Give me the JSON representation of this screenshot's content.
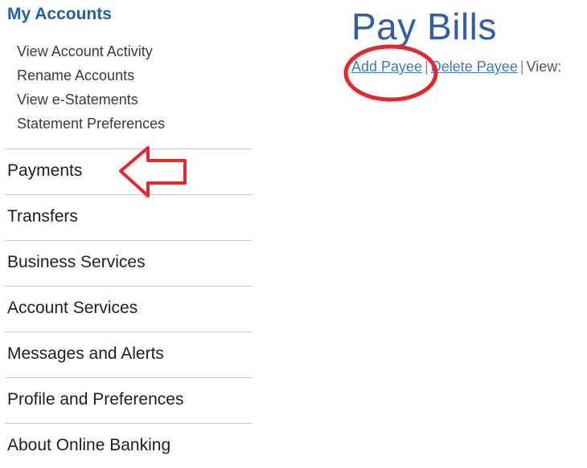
{
  "sidebar": {
    "section_title": "My Accounts",
    "sub_items": [
      {
        "label": "View Account Activity"
      },
      {
        "label": "Rename Accounts"
      },
      {
        "label": "View e-Statements"
      },
      {
        "label": "Statement Preferences"
      }
    ],
    "nav_items": [
      {
        "label": "Payments"
      },
      {
        "label": "Transfers"
      },
      {
        "label": "Business Services"
      },
      {
        "label": "Account Services"
      },
      {
        "label": "Messages and Alerts"
      },
      {
        "label": "Profile and Preferences"
      },
      {
        "label": "About Online Banking"
      }
    ]
  },
  "main": {
    "title": "Pay Bills",
    "actions": {
      "add_payee": "Add Payee",
      "separator": "|",
      "delete_payee": "Delete Payee",
      "view_label": "View:"
    }
  },
  "annotations": {
    "color": "#e8262b",
    "arrow_icon": "left-arrow-outline-icon",
    "highlight": "circle-highlight"
  }
}
